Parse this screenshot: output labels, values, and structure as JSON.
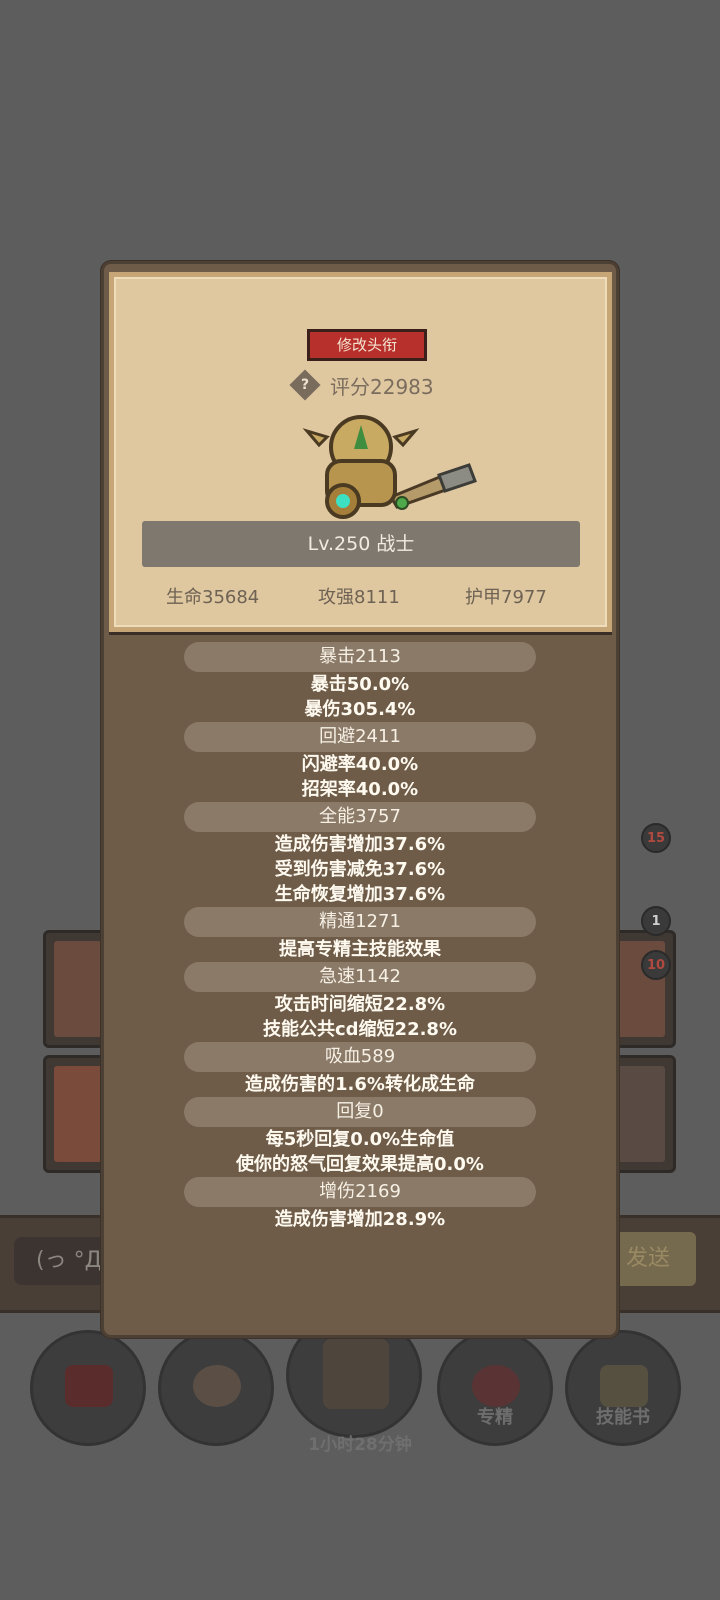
{
  "popup": {
    "title_button": "修改头衔",
    "score": "评分22983",
    "level_class": "Lv.250 战士",
    "basic_stats": {
      "hp": "生命35684",
      "attack": "攻强8111",
      "armor": "护甲7977"
    },
    "stat_groups": [
      {
        "head": "暴击2113",
        "lines": [
          "暴击50.0%",
          "暴伤305.4%"
        ]
      },
      {
        "head": "回避2411",
        "lines": [
          "闪避率40.0%",
          "招架率40.0%"
        ]
      },
      {
        "head": "全能3757",
        "lines": [
          "造成伤害增加37.6%",
          "受到伤害减免37.6%",
          "生命恢复增加37.6%"
        ]
      },
      {
        "head": "精通1271",
        "lines": [
          "提高专精主技能效果"
        ]
      },
      {
        "head": "急速1142",
        "lines": [
          "攻击时间缩短22.8%",
          "技能公共cd缩短22.8%"
        ]
      },
      {
        "head": "吸血589",
        "lines": [
          "造成伤害的1.6%转化成生命"
        ]
      },
      {
        "head": "回复0",
        "lines": [
          "每5秒回复0.0%生命值",
          "使你的怒气回复效果提高0.0%"
        ]
      },
      {
        "head": "增伤2169",
        "lines": [
          "造成伤害增加28.9%"
        ]
      }
    ]
  },
  "background": {
    "badges": [
      "15",
      "1",
      "10"
    ],
    "chat_placeholder": "(っ °Д °",
    "send_label": "发送",
    "bottom_buttons": [
      "专精",
      "技能书"
    ],
    "timer": "1小时28分钟"
  },
  "colors": {
    "overlay": "#5d5d5d",
    "parchment": "#dfc7a0",
    "panel": "#6e5c49",
    "title_button": "#b8302b"
  }
}
